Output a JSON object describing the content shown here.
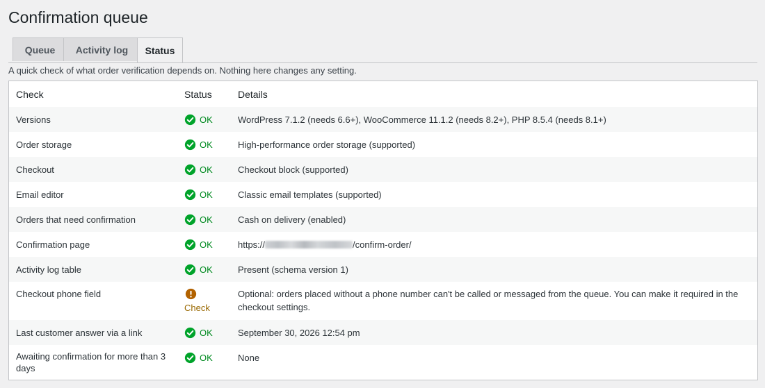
{
  "page": {
    "title": "Confirmation queue",
    "intro": "A quick check of what order verification depends on. Nothing here changes any setting."
  },
  "tabs": [
    {
      "label": "Queue",
      "active": false
    },
    {
      "label": "Activity log",
      "active": false
    },
    {
      "label": "Status",
      "active": true
    }
  ],
  "table": {
    "headers": {
      "check": "Check",
      "status": "Status",
      "details": "Details"
    },
    "rows": [
      {
        "check": "Versions",
        "status": "OK",
        "details": "WordPress 7.1.2 (needs 6.6+), WooCommerce 11.1.2 (needs 8.2+), PHP 8.5.4 (needs 8.1+)"
      },
      {
        "check": "Order storage",
        "status": "OK",
        "details": "High-performance order storage (supported)"
      },
      {
        "check": "Checkout",
        "status": "OK",
        "details": "Checkout block (supported)"
      },
      {
        "check": "Email editor",
        "status": "OK",
        "details": "Classic email templates (supported)"
      },
      {
        "check": "Orders that need confirmation",
        "status": "OK",
        "details": "Cash on delivery (enabled)"
      },
      {
        "check": "Confirmation page",
        "status": "OK",
        "details_prefix": "https://",
        "details_suffix": "/confirm-order/"
      },
      {
        "check": "Activity log table",
        "status": "OK",
        "details": "Present (schema version 1)"
      },
      {
        "check": "Checkout phone field",
        "status": "Check",
        "details": "Optional: orders placed without a phone number can't be called or messaged from the queue. You can make it required in the checkout settings."
      },
      {
        "check": "Last customer answer via a link",
        "status": "OK",
        "details": "September 30, 2026 12:54 pm"
      },
      {
        "check": "Awaiting confirmation for more than 3 days",
        "status": "OK",
        "details": "None"
      }
    ]
  },
  "colors": {
    "ok": "#008a20",
    "warning": "#996800",
    "ok_icon": "#00a32a",
    "warning_icon": "#b26200"
  },
  "icons": {
    "ok": "check-circle-icon",
    "warning": "exclamation-circle-icon"
  }
}
